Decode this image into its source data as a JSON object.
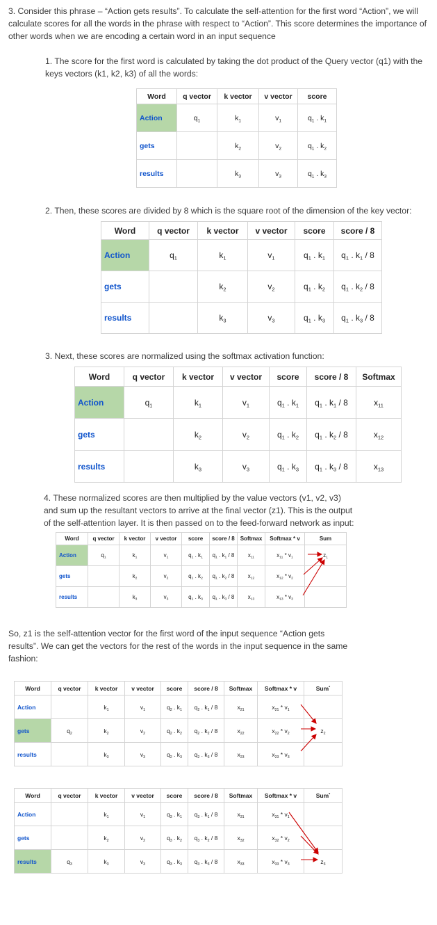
{
  "paragraphs": {
    "intro": "3. Consider this phrase – “Action gets results”. To calculate the self-attention for the first word “Action”, we will calculate scores for all the words in the phrase with respect to “Action”. This score determines the importance of other words when we are encoding a certain word in an input sequence",
    "step1": "1. The score for the first word is calculated by taking the dot product of the Query vector (q1) with the keys vectors (k1, k2, k3) of all the words:",
    "step2": "2. Then, these scores are divided by 8 which is the square root of the dimension of the key vector:",
    "step3": "3. Next, these scores are normalized using the softmax activation function:",
    "step4": "4. These normalized scores are then multiplied by the value vectors (v1, v2, v3) and sum up the resultant vectors to arrive at the final vector (z1). This is the output of the self-attention layer. It is then passed on to the feed-forward network as input:",
    "summary": "So, z1 is the self-attention vector for the first word of the input sequence “Action gets results”. We can get the vectors for the rest of the words in the input sequence in the same fashion:"
  },
  "headers": [
    "Word",
    "q vector",
    "k vector",
    "v vector",
    "score",
    "score / 8",
    "Softmax",
    "Softmax * v",
    "Sum"
  ],
  "words": [
    "Action",
    "gets",
    "results"
  ],
  "colors": {
    "highlight": "#b6d7a8",
    "word_link": "#1155cc",
    "arrow": "#cc0000",
    "border": "#d4d4d4"
  },
  "tables": [
    {
      "cols": 5,
      "highlight_row": 0,
      "rows": [
        [
          "Action",
          "q<sub>1</sub>",
          "k<sub>1</sub>",
          "v<sub>1</sub>",
          "q<sub>1</sub> . k<sub>1</sub>"
        ],
        [
          "gets",
          "",
          "k<sub>2</sub>",
          "v<sub>2</sub>",
          "q<sub>1</sub> . k<sub>2</sub>"
        ],
        [
          "results",
          "",
          "k<sub>3</sub>",
          "v<sub>3</sub>",
          "q<sub>1</sub> . k<sub>3</sub>"
        ]
      ]
    },
    {
      "cols": 6,
      "highlight_row": 0,
      "rows": [
        [
          "Action",
          "q<sub>1</sub>",
          "k<sub>1</sub>",
          "v<sub>1</sub>",
          "q<sub>1</sub> . k<sub>1</sub>",
          "q<sub>1</sub> . k<sub>1</sub> / 8"
        ],
        [
          "gets",
          "",
          "k<sub>2</sub>",
          "v<sub>2</sub>",
          "q<sub>1</sub> . k<sub>2</sub>",
          "q<sub>1</sub> . k<sub>2</sub> / 8"
        ],
        [
          "results",
          "",
          "k<sub>3</sub>",
          "v<sub>3</sub>",
          "q<sub>1</sub> . k<sub>3</sub>",
          "q<sub>1</sub> . k<sub>3</sub> / 8"
        ]
      ]
    },
    {
      "cols": 7,
      "highlight_row": 0,
      "rows": [
        [
          "Action",
          "q<sub>1</sub>",
          "k<sub>1</sub>",
          "v<sub>1</sub>",
          "q<sub>1</sub> . k<sub>1</sub>",
          "q<sub>1</sub> . k<sub>1</sub> / 8",
          "x<sub>11</sub>"
        ],
        [
          "gets",
          "",
          "k<sub>2</sub>",
          "v<sub>2</sub>",
          "q<sub>1</sub> . k<sub>2</sub>",
          "q<sub>1</sub> . k<sub>2</sub> / 8",
          "x<sub>12</sub>"
        ],
        [
          "results",
          "",
          "k<sub>3</sub>",
          "v<sub>3</sub>",
          "q<sub>1</sub> . k<sub>3</sub>",
          "q<sub>1</sub> . k<sub>3</sub> / 8",
          "x<sub>13</sub>"
        ]
      ]
    },
    {
      "cols": 9,
      "highlight_row": 0,
      "rows": [
        [
          "Action",
          "q<sub>1</sub>",
          "k<sub>1</sub>",
          "v<sub>1</sub>",
          "q<sub>1</sub> . k<sub>1</sub>",
          "q<sub>1</sub> . k<sub>1</sub> / 8",
          "x<sub>11</sub>",
          "x<sub>11</sub> * v<sub>1</sub>",
          "z<sub>1</sub>"
        ],
        [
          "gets",
          "",
          "k<sub>2</sub>",
          "v<sub>2</sub>",
          "q<sub>1</sub> . k<sub>2</sub>",
          "q<sub>1</sub> . k<sub>2</sub> / 8",
          "x<sub>12</sub>",
          "x<sub>12</sub> * v<sub>2</sub>",
          ""
        ],
        [
          "results",
          "",
          "k<sub>3</sub>",
          "v<sub>3</sub>",
          "q<sub>1</sub> . k<sub>3</sub>",
          "q<sub>1</sub> . k<sub>3</sub> / 8",
          "x<sub>13</sub>",
          "x<sub>13</sub> * v<sub>3</sub>",
          ""
        ]
      ]
    },
    {
      "cols": 9,
      "highlight_row": 1,
      "rows": [
        [
          "Action",
          "",
          "k<sub>1</sub>",
          "v<sub>1</sub>",
          "q<sub>2</sub> . k<sub>1</sub>",
          "q<sub>2</sub> . k<sub>1</sub> / 8",
          "x<sub>21</sub>",
          "x<sub>21</sub> * v<sub>1</sub>",
          ""
        ],
        [
          "gets",
          "q<sub>2</sub>",
          "k<sub>2</sub>",
          "v<sub>2</sub>",
          "q<sub>2</sub> . k<sub>2</sub>",
          "q<sub>2</sub> . k<sub>2</sub> / 8",
          "x<sub>22</sub>",
          "x<sub>22</sub> * v<sub>2</sub>",
          "z<sub>2</sub>"
        ],
        [
          "results",
          "",
          "k<sub>3</sub>",
          "v<sub>3</sub>",
          "q<sub>2</sub> . k<sub>3</sub>",
          "q<sub>2</sub> . k<sub>3</sub> / 8",
          "x<sub>23</sub>",
          "x<sub>23</sub> * v<sub>3</sub>",
          ""
        ]
      ]
    },
    {
      "cols": 9,
      "highlight_row": 2,
      "rows": [
        [
          "Action",
          "",
          "k<sub>1</sub>",
          "v<sub>1</sub>",
          "q<sub>3</sub> . k<sub>1</sub>",
          "q<sub>3</sub> . k<sub>1</sub> / 8",
          "x<sub>31</sub>",
          "x<sub>31</sub> * v<sub>1</sub>",
          ""
        ],
        [
          "gets",
          "",
          "k<sub>2</sub>",
          "v<sub>2</sub>",
          "q<sub>3</sub> . k<sub>2</sub>",
          "q<sub>3</sub> . k<sub>2</sub> / 8",
          "x<sub>32</sub>",
          "x<sub>32</sub> * v<sub>2</sub>",
          ""
        ],
        [
          "results",
          "q<sub>3</sub>",
          "k<sub>3</sub>",
          "v<sub>3</sub>",
          "q<sub>3</sub> . k<sub>3</sub>",
          "q<sub>3</sub> . k<sub>3</sub> / 8",
          "x<sub>33</sub>",
          "x<sub>33</sub> * v<sub>3</sub>",
          "z<sub>3</sub>"
        ]
      ]
    }
  ]
}
